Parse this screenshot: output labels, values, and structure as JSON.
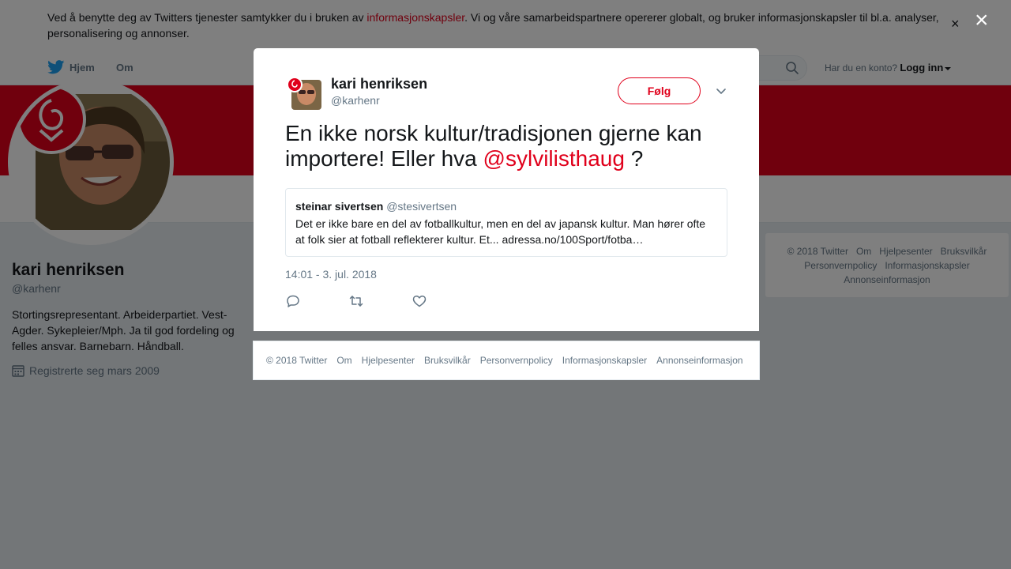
{
  "cookie": {
    "text_before": "Ved å benytte deg av Twitters tjenester samtykker du i bruken av ",
    "link": "informasjonskapsler",
    "text_after": ". Vi og våre samarbeidspartnere opererer globalt, og bruker informasjonskapsler til bl.a. analyser, personalisering og annonser.",
    "close": "×"
  },
  "nav": {
    "home": "Hjem",
    "about": "Om",
    "login_prompt": "Har du en konto?",
    "login": "Logg inn"
  },
  "profile": {
    "name": "kari henriksen",
    "handle": "@karhenr",
    "bio": "Stortingsrepresentant. Arbeiderpartiet. Vest-Agder. Sykepleier/Mph. Ja til god fordeling og felles ansvar. Barnebarn. Håndball.",
    "joined": "Registrerte seg mars 2009"
  },
  "side_footer": {
    "links": [
      "© 2018 Twitter",
      "Om",
      "Hjelpesenter",
      "Bruksvilkår",
      "Personvernpolicy",
      "Informasjonskapsler",
      "Annonseinformasjon"
    ]
  },
  "overlay": {
    "close": "×"
  },
  "tweet": {
    "author_name": "kari henriksen",
    "author_handle": "@karhenr",
    "follow": "Følg",
    "text": "En ikke norsk kultur/tradisjonen gjerne kan importere! Eller hva ",
    "mention": "@sylvilisthaug",
    "text_end": " ?",
    "quote": {
      "name": "steinar sivertsen",
      "handle": "@stesivertsen",
      "text": "Det er ikke bare en del av fotballkultur, men en del av japansk kultur. Man hører ofte at folk sier at fotball reflekterer kultur. Et... adressa.no/100Sport/fotba…"
    },
    "timestamp": "14:01 - 3. jul. 2018"
  },
  "modal_footer": {
    "links": [
      "© 2018 Twitter",
      "Om",
      "Hjelpesenter",
      "Bruksvilkår",
      "Personvernpolicy",
      "Informasjonskapsler",
      "Annonseinformasjon"
    ]
  },
  "colors": {
    "accent": "#e0001b",
    "twitter_blue": "#1da1f2",
    "overlay": "rgba(0,0,0,0.5)"
  },
  "icons": {
    "logo": "twitter-bird-icon",
    "search": "search-icon",
    "calendar": "calendar-icon",
    "more": "chevron-down-icon",
    "reply": "reply-icon",
    "retweet": "retweet-icon",
    "like": "heart-icon"
  }
}
